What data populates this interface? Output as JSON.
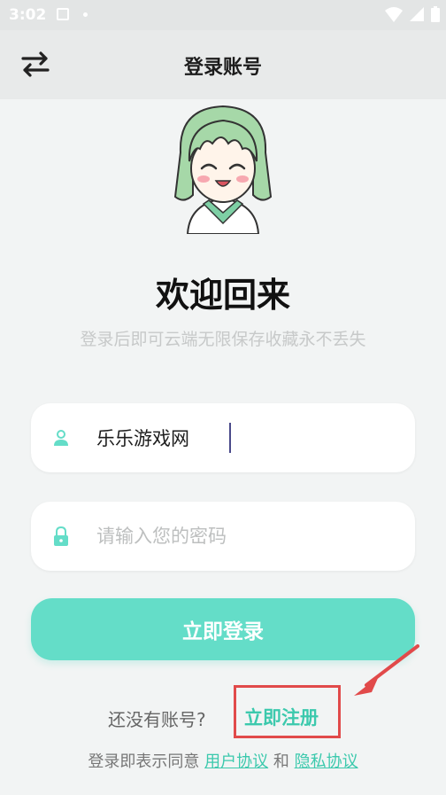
{
  "status_bar": {
    "time": "3:02"
  },
  "app_bar": {
    "title": "登录账号",
    "swap_icon": "swap-icon"
  },
  "hero": {
    "avatar_icon": "anime-girl-avatar"
  },
  "welcome": {
    "title": "欢迎回来",
    "subtitle": "登录后即可云端无限保存收藏永不丢失"
  },
  "form": {
    "username": {
      "value": "乐乐游戏网",
      "icon": "user-icon"
    },
    "password": {
      "placeholder": "请输入您的密码",
      "icon": "lock-icon"
    },
    "login_label": "立即登录"
  },
  "register": {
    "prompt": "还没有账号?",
    "link": "立即注册"
  },
  "terms": {
    "prefix": "登录即表示同意",
    "user_agreement": "用户协议",
    "and": "和",
    "privacy_policy": "隐私协议"
  },
  "colors": {
    "accent": "#64ddc8",
    "accent_text": "#3cc9ad",
    "highlight": "#e14a4a"
  }
}
